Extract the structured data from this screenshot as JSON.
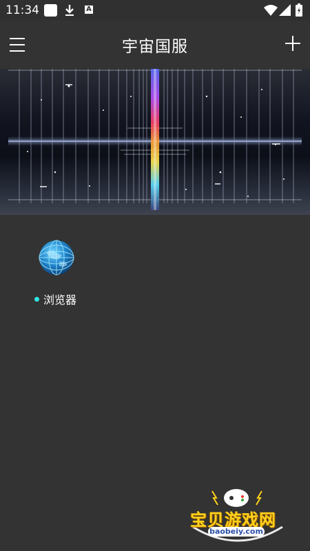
{
  "status_bar": {
    "time": "11:34",
    "icons": [
      "notification-square-icon",
      "download-icon",
      "a-icon",
      "wifi-icon",
      "signal-icon",
      "battery-icon"
    ],
    "a_glyph": "A"
  },
  "app_bar": {
    "title": "宇宙国服",
    "left_icon": "menu-icon",
    "right_icon": "add-icon"
  },
  "apps": [
    {
      "label": "浏览器",
      "icon": "globe-icon",
      "running": true
    }
  ],
  "watermark": {
    "text": "宝贝游戏网",
    "url": "baobeiy.com"
  },
  "colors": {
    "background": "#333333",
    "status_bar": "#303030",
    "status_dot": "#2ee6e0",
    "watermark_yellow": "#ffd21c"
  }
}
